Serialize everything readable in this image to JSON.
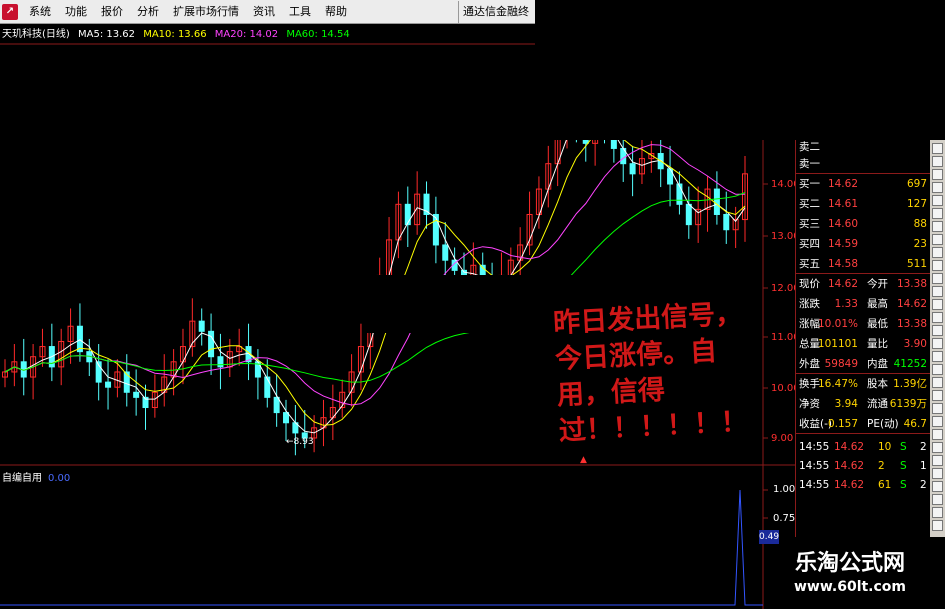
{
  "menu": {
    "items": [
      "系统",
      "功能",
      "报价",
      "分析",
      "扩展市场行情",
      "资讯",
      "工具",
      "帮助"
    ],
    "broker": "通达信金融终"
  },
  "header": {
    "stock": "天玑科技(日线)",
    "ma5": "MA5: 13.62",
    "ma10": "MA10: 13.66",
    "ma20": "MA20: 14.02",
    "ma60": "MA60: 14.54"
  },
  "colors": {
    "up": "#ff2a2a",
    "down": "#54ffff",
    "ma5": "#ffffff",
    "ma10": "#ffff00",
    "ma20": "#ff44ff",
    "ma60": "#00ff00",
    "grid": "#8b1a1a"
  },
  "price_axis": [
    "14.00",
    "13.00",
    "12.00",
    "11.00",
    "10.00",
    "9.00"
  ],
  "low_label": "8.93",
  "indicator": {
    "name": "自编自用",
    "value": "0.00",
    "axis": [
      "1.00",
      "0.75"
    ],
    "current": "0.49"
  },
  "panel": {
    "sell_partial": [
      "卖二",
      "卖一"
    ],
    "buy": [
      {
        "label": "买一",
        "price": "14.62",
        "vol": "697"
      },
      {
        "label": "买二",
        "price": "14.61",
        "vol": "127"
      },
      {
        "label": "买三",
        "price": "14.60",
        "vol": "88"
      },
      {
        "label": "买四",
        "price": "14.59",
        "vol": "23"
      },
      {
        "label": "买五",
        "price": "14.58",
        "vol": "511"
      }
    ],
    "stats": [
      {
        "l1": "现价",
        "v1": "14.62",
        "l2": "今开",
        "v2": "13.38"
      },
      {
        "l1": "涨跌",
        "v1": "1.33",
        "l2": "最高",
        "v2": "14.62"
      },
      {
        "l1": "涨幅",
        "v1": "10.01%",
        "l2": "最低",
        "v2": "13.38"
      },
      {
        "l1": "总量",
        "v1": "101101",
        "l2": "量比",
        "v2": "3.90"
      },
      {
        "l1": "外盘",
        "v1": "59849",
        "l2": "内盘",
        "v2": "41252"
      }
    ],
    "stats2": [
      {
        "l1": "换手",
        "v1": "16.47%",
        "l2": "股本",
        "v2": "1.39亿"
      },
      {
        "l1": "净资",
        "v1": "3.94",
        "l2": "流通",
        "v2": "6139万"
      },
      {
        "l1": "收益(-)",
        "v1": "0.157",
        "l2": "PE(动)",
        "v2": "46.7"
      }
    ],
    "ticks": [
      {
        "time": "14:55",
        "price": "14.62",
        "vol": "10",
        "flag": "S",
        "n": "2"
      },
      {
        "time": "14:55",
        "price": "14.62",
        "vol": "2",
        "flag": "S",
        "n": "1"
      },
      {
        "time": "14:55",
        "price": "14.62",
        "vol": "61",
        "flag": "S",
        "n": "2"
      }
    ]
  },
  "annotation": "昨日发出信号，今日涨停。自用，信得过！！！！！！",
  "watermark": {
    "cn": "乐淘公式网",
    "url": "www.60lt.com"
  }
}
